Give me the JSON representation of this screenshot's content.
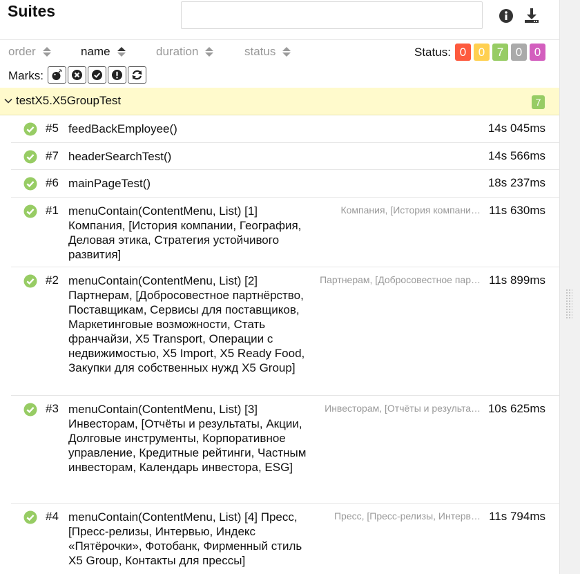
{
  "header": {
    "title": "Suites",
    "search": {
      "value": "",
      "placeholder": ""
    },
    "icons": [
      "info-icon",
      "download-icon"
    ]
  },
  "sort": {
    "items": [
      {
        "label": "order",
        "active": false
      },
      {
        "label": "name",
        "active": true
      },
      {
        "label": "duration",
        "active": false
      },
      {
        "label": "status",
        "active": false
      }
    ]
  },
  "status_filter": {
    "label": "Status:",
    "badges": [
      {
        "name": "failed",
        "count": "0",
        "color": "#fd5a3e"
      },
      {
        "name": "broken",
        "count": "0",
        "color": "#ffd050"
      },
      {
        "name": "passed",
        "count": "7",
        "color": "#97cc64"
      },
      {
        "name": "skipped",
        "count": "0",
        "color": "#aaaaaa"
      },
      {
        "name": "unknown",
        "count": "0",
        "color": "#d35ebe"
      }
    ]
  },
  "marks": {
    "label": "Marks:",
    "buttons": [
      "flaky-bomb-icon",
      "new-failed-icon",
      "new-passed-icon",
      "new-broken-icon",
      "retries-icon"
    ]
  },
  "group": {
    "name": "testX5.X5GroupTest",
    "count": "7"
  },
  "tests": [
    {
      "num": "#5",
      "name": "feedBackEmployee()",
      "params": "",
      "duration": "14s 045ms"
    },
    {
      "num": "#7",
      "name": "headerSearchTest()",
      "params": "",
      "duration": "14s 566ms"
    },
    {
      "num": "#6",
      "name": "mainPageTest()",
      "params": "",
      "duration": "18s 237ms"
    },
    {
      "num": "#1",
      "name": "menuContain(ContentMenu, List) [1] Компания, [История компании, География, Деловая этика, Стратегия устойчивого развития]",
      "params": "Компания, [История компани…",
      "duration": "11s 630ms"
    },
    {
      "num": "#2",
      "name": "menuContain(ContentMenu, List) [2] Партнерам, [Добросовестное партнёрство, Поставщикам, Сервисы для поставщиков, Маркетинговые возможности, Стать франчайзи, X5 Transport, Операции с недвижимостью, X5 Import, X5 Ready Food, Закупки для собственных нужд X5 Group]",
      "params": "Партнерам, [Добросовестное пар…",
      "duration": "11s 899ms"
    },
    {
      "num": "#3",
      "name": "menuContain(ContentMenu, List) [3] Инвесторам, [Отчёты и результаты, Акции, Долговые инструменты, Корпоративное управление, Кредитные рейтинги, Частным инвесторам, Календарь инвестора, ESG]",
      "params": "Инвесторам, [Отчёты и результа…",
      "duration": "10s 625ms"
    },
    {
      "num": "#4",
      "name": "menuContain(ContentMenu, List) [4] Пресс, [Пресс-релизы, Интервью, Индекс «Пятёрочки», Фотобанк, Фирменный стиль X5 Group, Контакты для прессы]",
      "params": "Пресс, [Пресс-релизы, Интерв…",
      "duration": "11s 794ms"
    }
  ],
  "status_icon": "passed-check-icon"
}
